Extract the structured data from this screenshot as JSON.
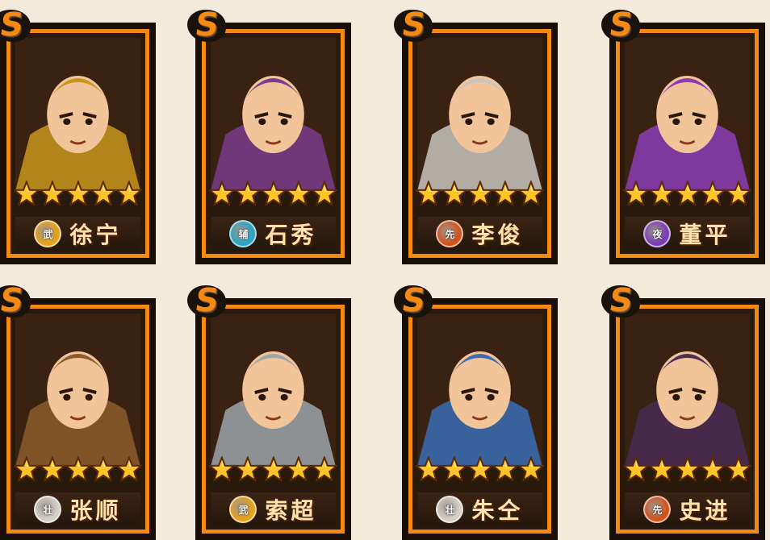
{
  "cards": [
    {
      "name": "徐宁",
      "faction": "武",
      "faction_color": "#e6a21a",
      "rarity": "S",
      "stars": 5,
      "theme": "#c8961c"
    },
    {
      "name": "石秀",
      "faction": "辅",
      "faction_color": "#2aa6c4",
      "rarity": "S",
      "stars": 5,
      "theme": "#7a3c8c"
    },
    {
      "name": "李俊",
      "faction": "先",
      "faction_color": "#d2541c",
      "rarity": "S",
      "stars": 5,
      "theme": "#c8c4c0"
    },
    {
      "name": "董平",
      "faction": "夜",
      "faction_color": "#7a3cb4",
      "rarity": "S",
      "stars": 5,
      "theme": "#8c3cb4"
    },
    {
      "name": "张顺",
      "faction": "壮",
      "faction_color": "#d4d0c8",
      "rarity": "S",
      "stars": 5,
      "theme": "#8c5a2c"
    },
    {
      "name": "索超",
      "faction": "武",
      "faction_color": "#e6a21a",
      "rarity": "S",
      "stars": 5,
      "theme": "#9ca4ac"
    },
    {
      "name": "朱仝",
      "faction": "壮",
      "faction_color": "#d4d0c8",
      "rarity": "S",
      "stars": 5,
      "theme": "#3a6cb4"
    },
    {
      "name": "史进",
      "faction": "先",
      "faction_color": "#d2541c",
      "rarity": "S",
      "stars": 5,
      "theme": "#4a2c54"
    }
  ]
}
